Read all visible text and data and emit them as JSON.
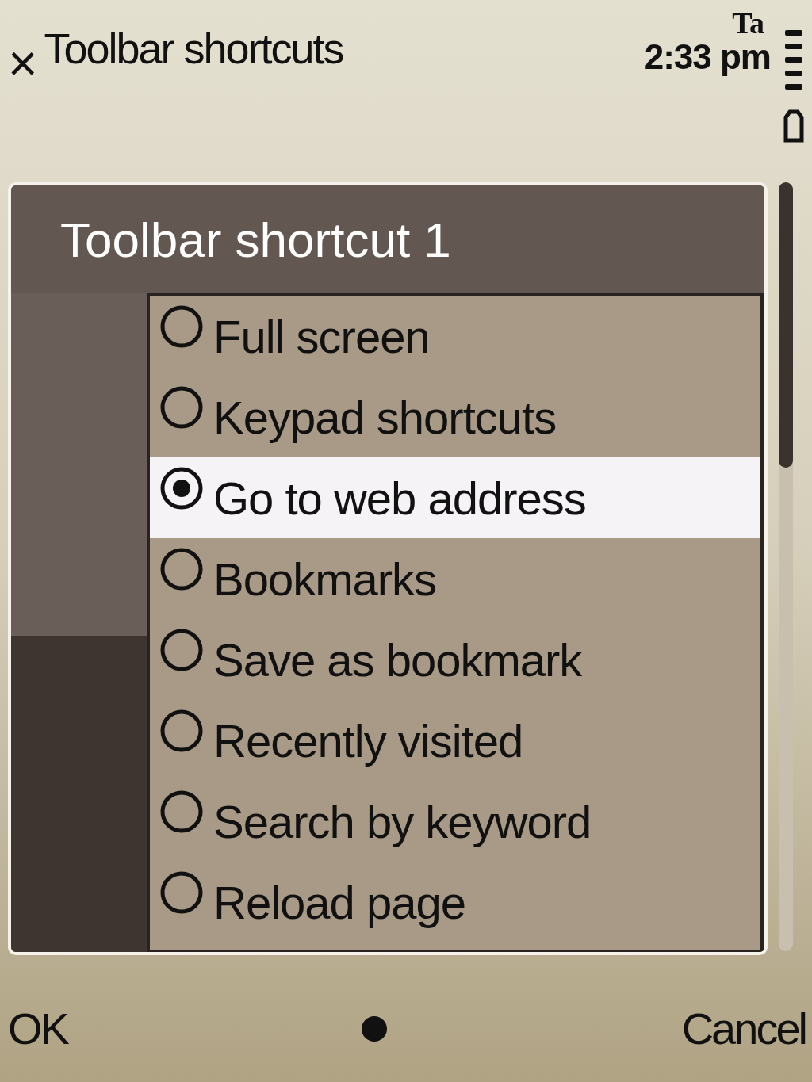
{
  "header": {
    "close": "×",
    "title": "Toolbar shortcuts",
    "network": "Ta",
    "time": "2:33 pm"
  },
  "dialog": {
    "title": "Toolbar shortcut 1",
    "options": [
      {
        "label": "Full screen",
        "selected": false
      },
      {
        "label": "Keypad shortcuts",
        "selected": false
      },
      {
        "label": "Go to web address",
        "selected": true
      },
      {
        "label": "Bookmarks",
        "selected": false
      },
      {
        "label": "Save as bookmark",
        "selected": false
      },
      {
        "label": "Recently visited",
        "selected": false
      },
      {
        "label": "Search by keyword",
        "selected": false
      },
      {
        "label": "Reload page",
        "selected": false
      }
    ]
  },
  "softkeys": {
    "left": "OK",
    "right": "Cancel"
  }
}
